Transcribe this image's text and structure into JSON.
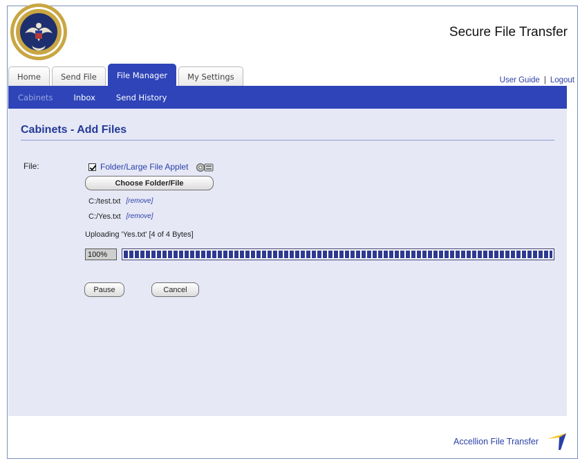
{
  "header": {
    "title": "Secure File Transfer"
  },
  "tabs": [
    {
      "label": "Home"
    },
    {
      "label": "Send File"
    },
    {
      "label": "File Manager"
    },
    {
      "label": "My Settings"
    }
  ],
  "top_links": {
    "user_guide": "User Guide",
    "separator": "|",
    "logout": "Logout"
  },
  "subnav": [
    {
      "label": "Cabinets"
    },
    {
      "label": "Inbox"
    },
    {
      "label": "Send History"
    }
  ],
  "main": {
    "page_title": "Cabinets - Add Files",
    "file_label": "File:",
    "applet_checkbox_checked": true,
    "applet_label": "Folder/Large File Applet",
    "choose_button": "Choose Folder/File",
    "files": [
      {
        "path": "C:/test.txt",
        "remove": "[remove]"
      },
      {
        "path": "C:/Yes.txt",
        "remove": "[remove]"
      }
    ],
    "upload_status": "Uploading 'Yes.txt' [4 of 4 Bytes]",
    "progress_text": "100%",
    "progress_fraction": 1.0,
    "pause_button": "Pause",
    "cancel_button": "Cancel"
  },
  "footer": {
    "brand": "Accellion File Transfer"
  },
  "colors": {
    "nav_blue": "#2e44b8",
    "panel_bg": "#e6e8f6",
    "title_blue": "#233a96",
    "link_blue": "#2a3fa6",
    "progress_blue": "#2e3a8f",
    "logo_yellow": "#f2c21b"
  }
}
